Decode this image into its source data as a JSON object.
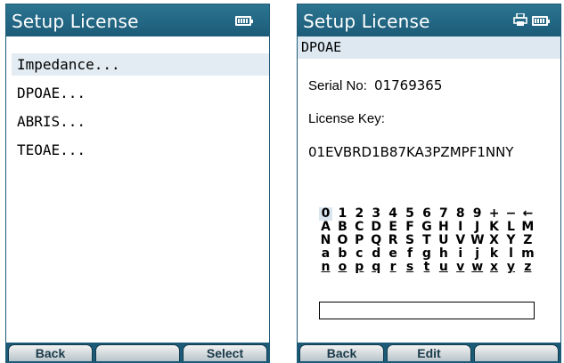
{
  "left": {
    "title": "Setup License",
    "items": [
      "Impedance...",
      "DPOAE...",
      "ABRIS...",
      "TEOAE..."
    ],
    "selected_index": 0,
    "softkeys": [
      "Back",
      "",
      "Select"
    ]
  },
  "right": {
    "title": "Setup License",
    "subheader": "DPOAE",
    "serial_label": "Serial No:",
    "serial_value": "01769365",
    "license_label": "License Key:",
    "license_value": "01EVBRD1B87KA3PZMPF1NNY",
    "charset_rows": [
      [
        "0",
        "1",
        "2",
        "3",
        "4",
        "5",
        "6",
        "7",
        "8",
        "9",
        "+",
        "−",
        "←"
      ],
      [
        "A",
        "B",
        "C",
        "D",
        "E",
        "F",
        "G",
        "H",
        "I",
        "J",
        "K",
        "L",
        "M"
      ],
      [
        "N",
        "O",
        "P",
        "Q",
        "R",
        "S",
        "T",
        "U",
        "V",
        "W",
        "X",
        "Y",
        "Z"
      ],
      [
        "a",
        "b",
        "c",
        "d",
        "e",
        "f",
        "g",
        "h",
        "i",
        "j",
        "k",
        "l",
        "m"
      ],
      [
        "n",
        "o",
        "p",
        "q",
        "r",
        "s",
        "t",
        "u",
        "v",
        "w",
        "x",
        "y",
        "z"
      ]
    ],
    "entry_value": "",
    "softkeys": [
      "Back",
      "Edit",
      ""
    ]
  },
  "icons": [
    "battery-icon",
    "printer-icon"
  ],
  "colors": {
    "titlebar": "#1c5b78",
    "highlight": "#e3ecf2"
  }
}
